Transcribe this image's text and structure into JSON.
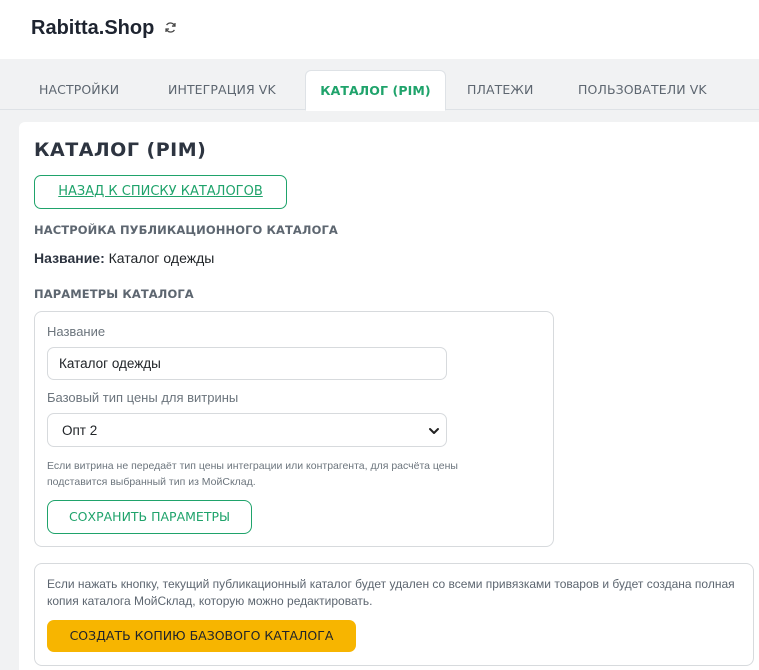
{
  "app": {
    "brand": "Rabitta.Shop",
    "refresh_icon": "refresh-icon"
  },
  "tabs": [
    {
      "label": "НАСТРОЙКИ",
      "active": false
    },
    {
      "label": "ИНТЕГРАЦИЯ VK",
      "active": false
    },
    {
      "label": "КАТАЛОГ (PIM)",
      "active": true
    },
    {
      "label": "ПЛАТЕЖИ",
      "active": false
    },
    {
      "label": "ПОЛЬЗОВАТЕЛИ VK",
      "active": false
    }
  ],
  "main": {
    "title": "КАТАЛОГ (PIM)",
    "back_button": "НАЗАД К СПИСКУ КАТАЛОГОВ",
    "section_publish": "НАСТРОЙКА ПУБЛИКАЦИОННОГО КАТАЛОГА",
    "name_label": "Название:",
    "name_value": "Каталог одежды",
    "section_params": "ПАРАМЕТРЫ КАТАЛОГА"
  },
  "params": {
    "name_field_label": "Название",
    "name_field_value": "Каталог одежды",
    "price_type_label": "Базовый тип цены для витрины",
    "price_type_selected": "Опт 2",
    "hint": "Если витрина не передаёт тип цены интеграции или контрагента, для расчёта цены подставится выбранный тип из МойСклад.",
    "save_button": "СОХРАНИТЬ ПАРАМЕТРЫ"
  },
  "copy": {
    "note": "Если нажать кнопку, текущий публикационный каталог будет удален со всеми привязками товаров и будет создана полная копия каталога МойСклад, которую можно редактировать.",
    "button": "СОЗДАТЬ КОПИЮ БАЗОВОГО КАТАЛОГА"
  },
  "colors": {
    "accent": "#1fa36b",
    "warning": "#f7b500",
    "page_bg": "#f1f2f3"
  }
}
